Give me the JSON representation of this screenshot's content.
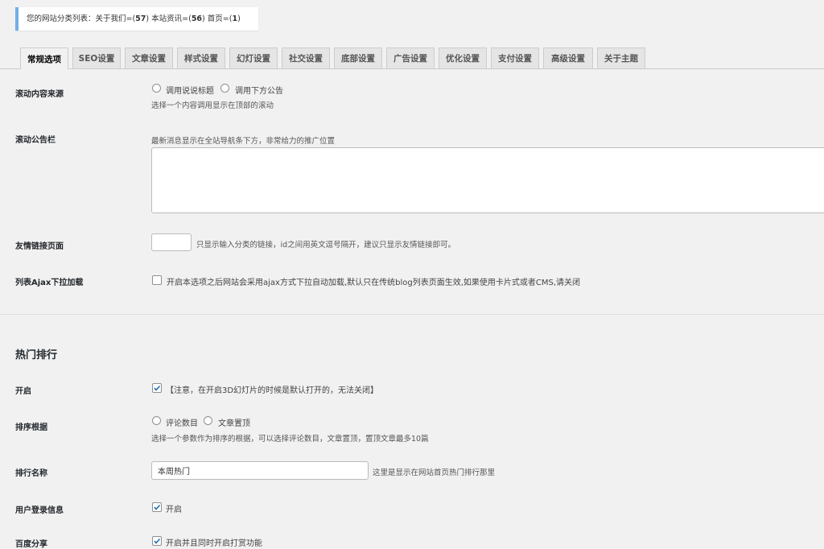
{
  "notice": {
    "prefix": "您的网站分类列表：关于我们=(",
    "c1": "57",
    "mid1": ")  本站资讯=(",
    "c2": "56",
    "mid2": ")  首页=(",
    "c3": "1",
    "suffix": ")"
  },
  "tabs": [
    "常规选项",
    "SEO设置",
    "文章设置",
    "样式设置",
    "幻灯设置",
    "社交设置",
    "底部设置",
    "广告设置",
    "优化设置",
    "支付设置",
    "高级设置",
    "关于主题"
  ],
  "active_tab": "常规选项",
  "scroll_source": {
    "label": "滚动内容来源",
    "option1": "调用说说标题",
    "option2": "调用下方公告",
    "desc": "选择一个内容调用显示在顶部的滚动"
  },
  "scroll_notice": {
    "label": "滚动公告栏",
    "desc": "最新消息显示在全站导航条下方，非常给力的推广位置",
    "value": ""
  },
  "friend_links": {
    "label": "友情链接页面",
    "value": "",
    "desc": "只显示输入分类的链接，id之间用英文逗号隔开，建议只显示友情链接即可。"
  },
  "ajax_load": {
    "label": "列表Ajax下拉加载",
    "checked": false,
    "desc": "开启本选项之后网站会采用ajax方式下拉自动加载,默认只在传统blog列表页面生效,如果使用卡片式或者CMS,请关闭"
  },
  "hot_section": {
    "title": "热门排行"
  },
  "enable": {
    "label": "开启",
    "checked": true,
    "desc": "【注意，在开启3D幻灯片的时候是默认打开的，无法关闭】"
  },
  "sort_by": {
    "label": "排序根据",
    "option1": "评论数目",
    "option2": "文章置顶",
    "desc": "选择一个参数作为排序的根据，可以选择评论数目，文章置顶，置顶文章最多10篇"
  },
  "rank_name": {
    "label": "排行名称",
    "value": "本周热门",
    "desc": "这里是显示在网站首页热门排行那里"
  },
  "user_login": {
    "label": "用户登录信息",
    "checked": true,
    "desc": "开启"
  },
  "baidu_share": {
    "label": "百度分享",
    "checked": true,
    "desc": "开启并且同时开启打赏功能"
  },
  "colors": {
    "accent": "#72aee6",
    "check": "#2271b1"
  }
}
